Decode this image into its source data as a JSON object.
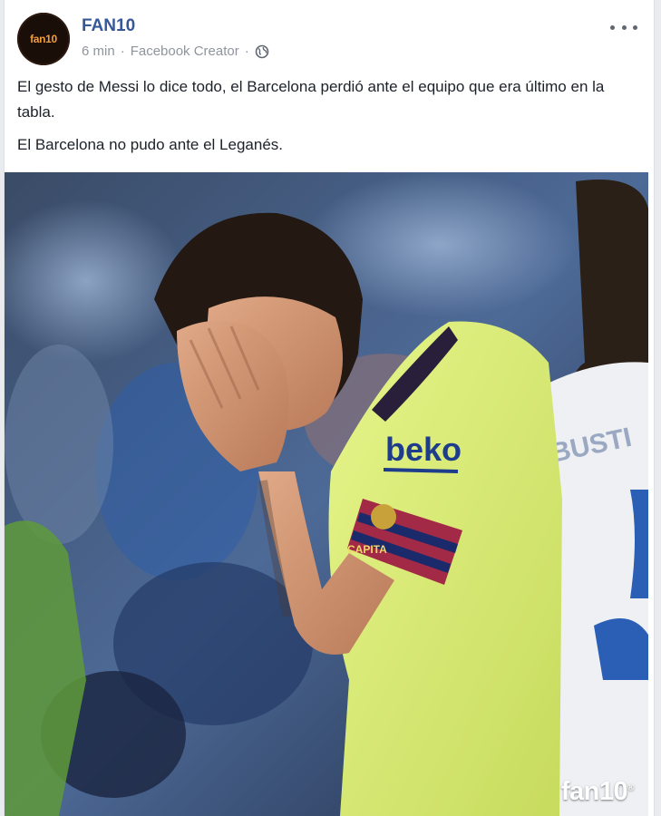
{
  "post": {
    "avatar_text": "fan10",
    "page_name": "FAN10",
    "time": "6 min",
    "source": "Facebook Creator",
    "text_paragraphs": [
      "El gesto de Messi lo dice todo, el Barcelona perdió ante el equipo que era último en la tabla.",
      "El Barcelona no pudo ante el Leganés."
    ],
    "photo": {
      "jersey_sponsor": "beko",
      "armband_text": "CAPITA",
      "opponent_shirt_name": "BUSTI",
      "watermark": "fan10",
      "watermark_mark": "®"
    }
  },
  "icons": {
    "privacy": "globe-icon",
    "menu": "more-options-icon"
  }
}
